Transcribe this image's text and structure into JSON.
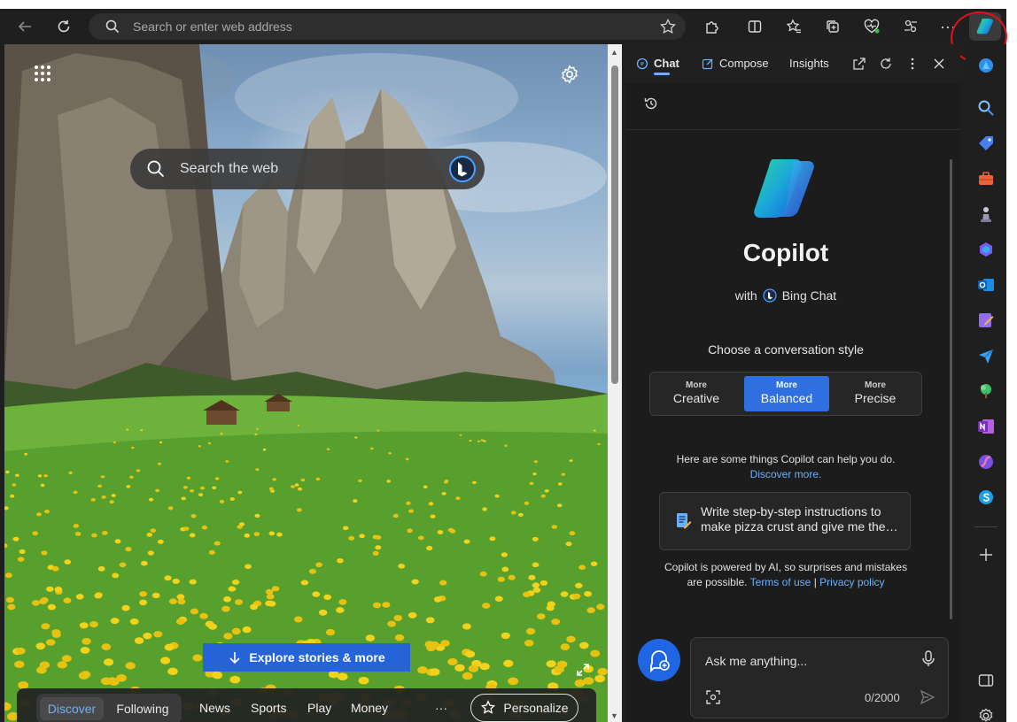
{
  "browser": {
    "address_placeholder": "Search or enter web address",
    "toolbar_icons": [
      "back-icon",
      "refresh-icon",
      "search-icon",
      "favorite-star-icon",
      "extensions-icon",
      "split-screen-icon",
      "favorites-icon",
      "collections-icon",
      "browser-essentials-icon",
      "performance-icon",
      "more-icon",
      "copilot-icon"
    ]
  },
  "newtab": {
    "search_placeholder": "Search the web",
    "explore_label": "Explore stories & more",
    "nav": {
      "discover": "Discover",
      "following": "Following",
      "links": [
        "News",
        "Sports",
        "Play",
        "Money"
      ],
      "more": "···",
      "personalize": "Personalize"
    }
  },
  "copilot": {
    "tabs": {
      "chat": "Chat",
      "compose": "Compose",
      "insights": "Insights"
    },
    "title": "Copilot",
    "with_prefix": "with",
    "with_name": "Bing Chat",
    "choose_label": "Choose a conversation style",
    "styles": [
      {
        "more": "More",
        "name": "Creative"
      },
      {
        "more": "More",
        "name": "Balanced"
      },
      {
        "more": "More",
        "name": "Precise"
      }
    ],
    "help_text": "Here are some things Copilot can help you do.",
    "discover_more": "Discover more.",
    "suggestion": "Write step-by-step instructions to make pizza crust and give me the…",
    "disclaimer_a": "Copilot is powered by AI, so surprises and mistakes",
    "disclaimer_b": "are possible.",
    "terms": "Terms of use",
    "separator": "|",
    "privacy": "Privacy policy",
    "input_placeholder": "Ask me anything...",
    "char_count": "0/2000"
  },
  "colors": {
    "accent": "#2f6fe0",
    "link": "#6ab0ff",
    "highlight_circle": "#e0121c"
  }
}
